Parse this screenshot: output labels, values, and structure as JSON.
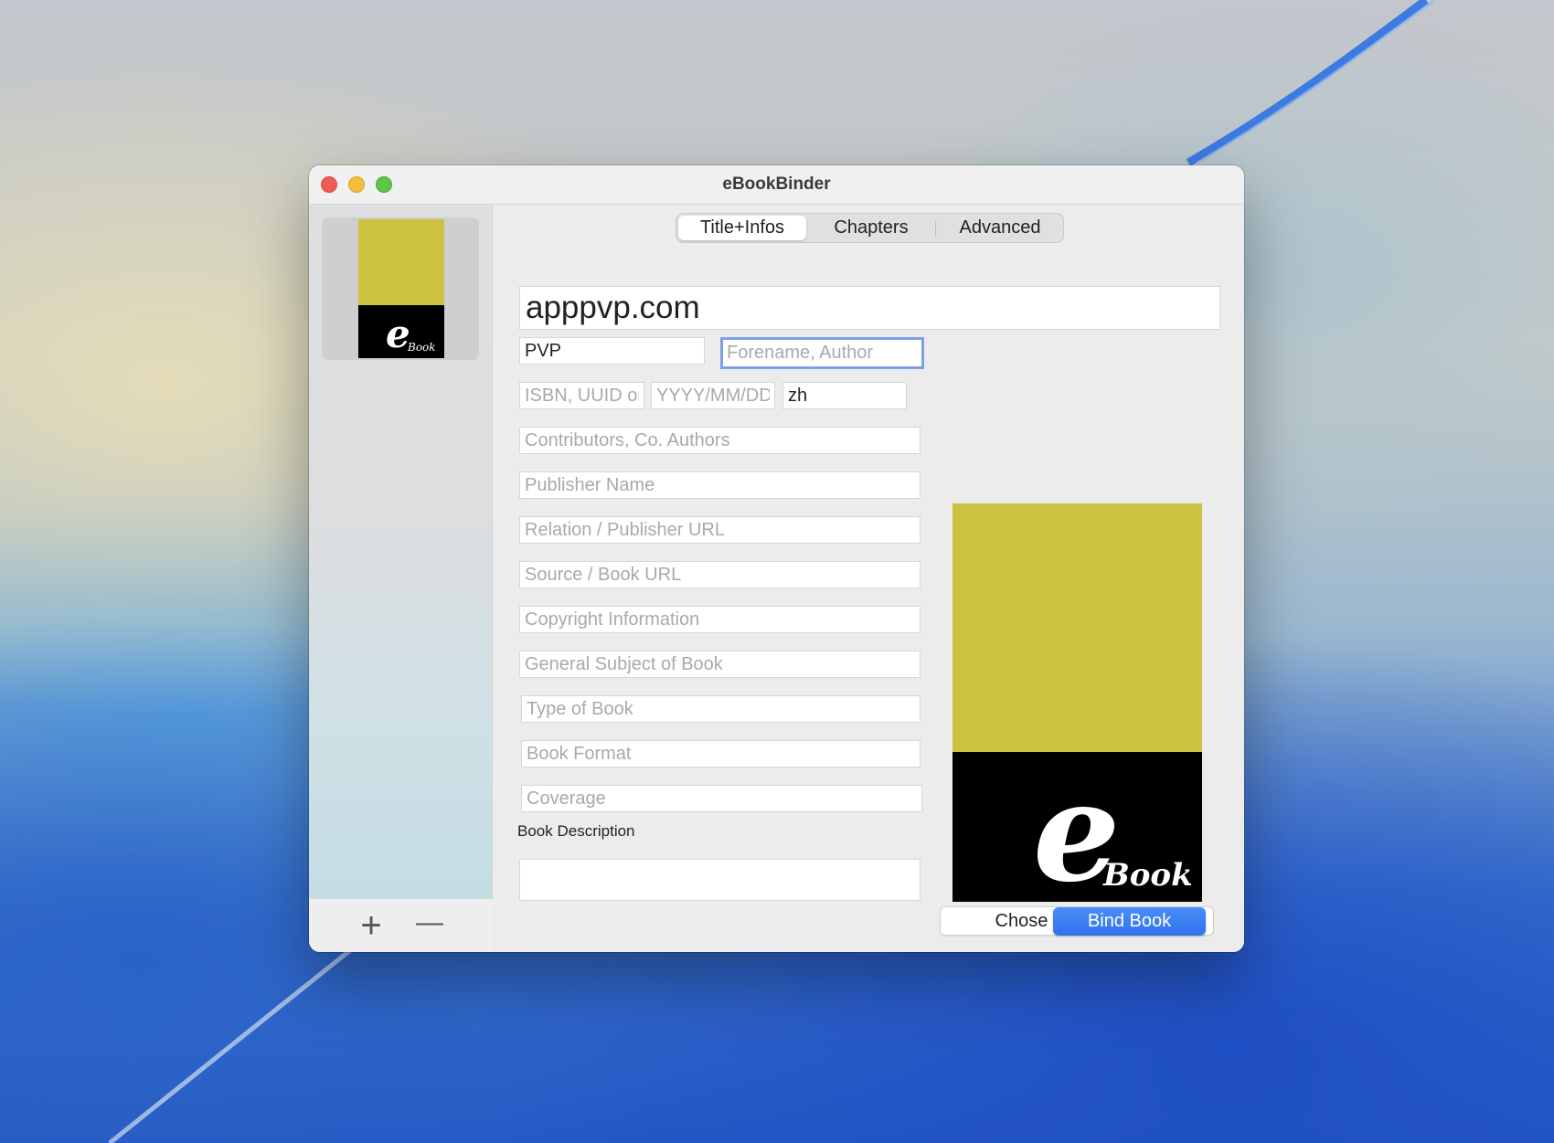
{
  "window": {
    "title": "eBookBinder"
  },
  "sidebar": {
    "items": [
      {
        "cover_letter": "e",
        "cover_word": "Book"
      }
    ],
    "add_label": "+",
    "remove_label": "—"
  },
  "tabs": [
    {
      "label": "Title+Infos",
      "active": true
    },
    {
      "label": "Chapters",
      "active": false
    },
    {
      "label": "Advanced",
      "active": false
    }
  ],
  "form": {
    "title": {
      "value": "apppvp.com",
      "placeholder": ""
    },
    "author_last": {
      "value": "PVP",
      "placeholder": ""
    },
    "author_first": {
      "value": "",
      "placeholder": "Forename, Author"
    },
    "identifier": {
      "value": "",
      "placeholder": "ISBN, UUID or"
    },
    "date": {
      "value": "",
      "placeholder": "YYYY/MM/DD"
    },
    "language": {
      "value": "zh",
      "placeholder": ""
    },
    "contributors": {
      "value": "",
      "placeholder": "Contributors, Co. Authors"
    },
    "publisher": {
      "value": "",
      "placeholder": "Publisher Name"
    },
    "relation": {
      "value": "",
      "placeholder": "Relation / Publisher URL"
    },
    "source": {
      "value": "",
      "placeholder": "Source / Book URL"
    },
    "copyright": {
      "value": "",
      "placeholder": "Copyright Information"
    },
    "subject": {
      "value": "",
      "placeholder": "General Subject of Book"
    },
    "type": {
      "value": "",
      "placeholder": "Type of Book"
    },
    "format": {
      "value": "",
      "placeholder": "Book Format"
    },
    "coverage": {
      "value": "",
      "placeholder": "Coverage"
    },
    "description_label": "Book Description",
    "description": {
      "value": ""
    }
  },
  "cover": {
    "top_color": "#cbc33f",
    "bottom_color": "#000000",
    "letter": "e",
    "word": "Book",
    "choose_label": "Chose Cover-Image"
  },
  "actions": {
    "bind_label": "Bind Book",
    "accent_color": "#3b7ff2"
  }
}
